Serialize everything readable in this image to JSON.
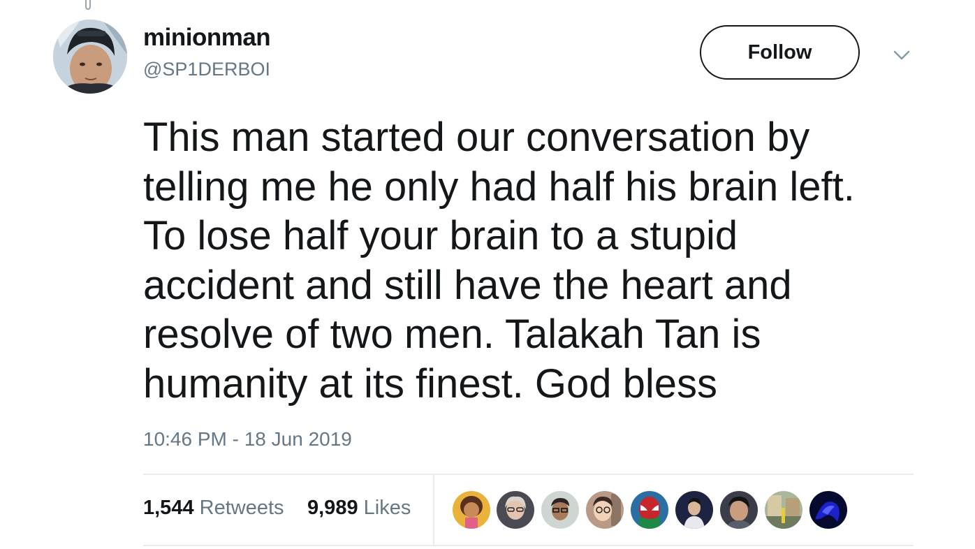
{
  "user": {
    "display_name": "minionman",
    "handle": "@SP1DERBOI"
  },
  "follow_button": {
    "label": "Follow"
  },
  "tweet": {
    "lines": [
      "This man started our conversation by",
      "telling me he only had half his brain left.",
      "To lose half your brain to a stupid",
      "accident and still have the heart and",
      "resolve of two men. Talakah Tan is",
      "humanity at its finest. God bless"
    ],
    "timestamp": "10:46 PM - 18 Jun 2019"
  },
  "stats": {
    "retweets": {
      "count": "1,544",
      "label": "Retweets"
    },
    "likes": {
      "count": "9,989",
      "label": "Likes"
    }
  },
  "likers": [
    {
      "icon": "dora-avatar",
      "color": "#e9b23a"
    },
    {
      "icon": "woman-glasses-avatar",
      "color": "#4a4a52"
    },
    {
      "icon": "man-glasses-avatar",
      "color": "#cfd6d2"
    },
    {
      "icon": "cartoon-man-avatar",
      "color": "#b89a86"
    },
    {
      "icon": "spiderman-avatar",
      "color": "#2b6ea3"
    },
    {
      "icon": "person-avatar",
      "color": "#1d2340"
    },
    {
      "icon": "young-man-avatar",
      "color": "#3b3d48"
    },
    {
      "icon": "street-scene-avatar",
      "color": "#a9b79a"
    },
    {
      "icon": "blue-abstract-avatar",
      "color": "#1a22c8"
    }
  ],
  "colors": {
    "text_primary": "#14171a",
    "text_secondary": "#657786",
    "divider": "#e6ecf0"
  }
}
